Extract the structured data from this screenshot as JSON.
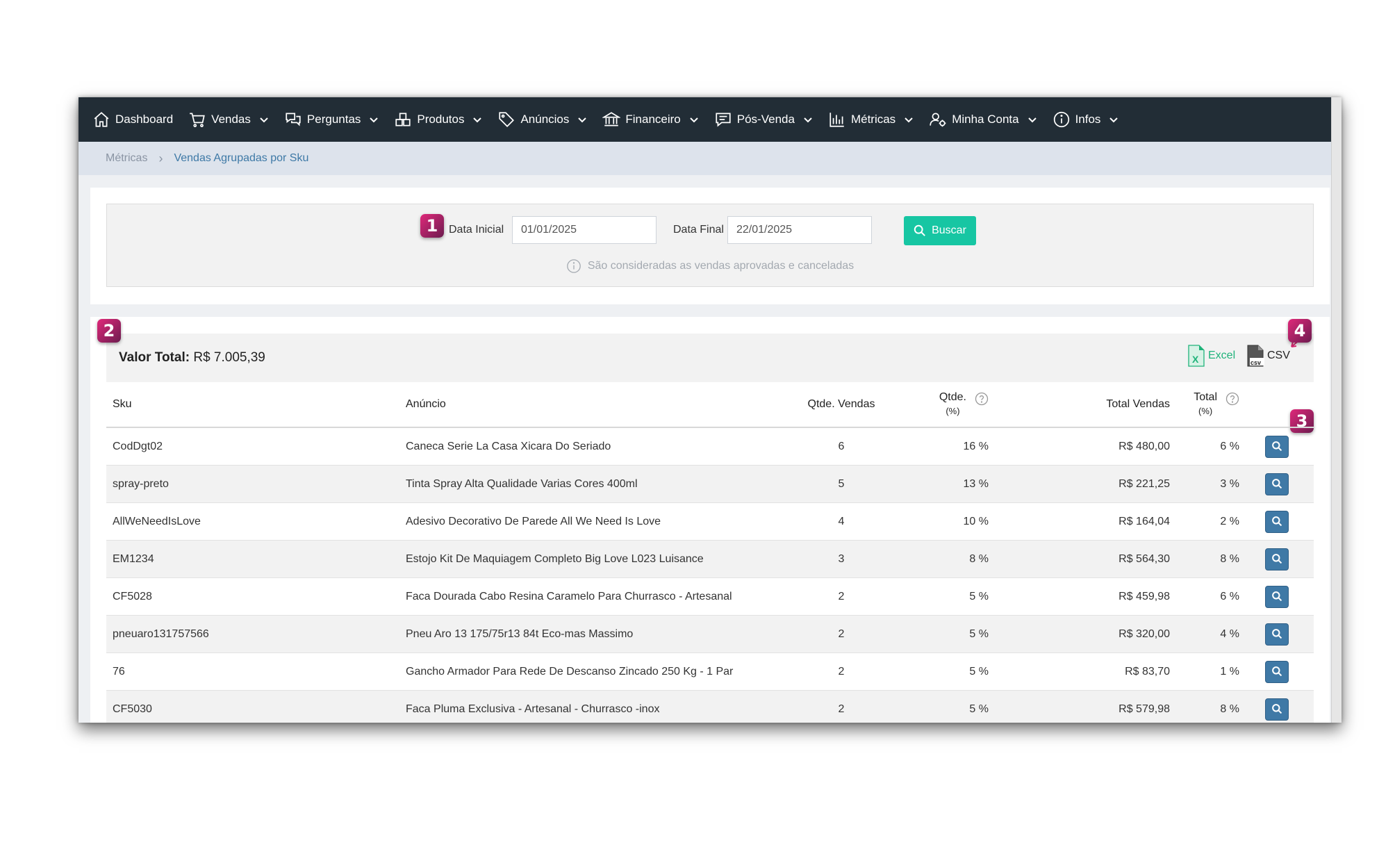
{
  "nav": {
    "items": [
      {
        "label": "Dashboard",
        "icon": "home-icon",
        "dropdown": false
      },
      {
        "label": "Vendas",
        "icon": "cart-icon",
        "dropdown": true
      },
      {
        "label": "Perguntas",
        "icon": "chat-bubbles-icon",
        "dropdown": true
      },
      {
        "label": "Produtos",
        "icon": "boxes-icon",
        "dropdown": true
      },
      {
        "label": "Anúncios",
        "icon": "tag-icon",
        "dropdown": true
      },
      {
        "label": "Financeiro",
        "icon": "bank-icon",
        "dropdown": true
      },
      {
        "label": "Pós-Venda",
        "icon": "message-icon",
        "dropdown": true
      },
      {
        "label": "Métricas",
        "icon": "bar-chart-icon",
        "dropdown": true
      },
      {
        "label": "Minha Conta",
        "icon": "user-gear-icon",
        "dropdown": true
      },
      {
        "label": "Infos",
        "icon": "info-icon",
        "dropdown": true
      }
    ]
  },
  "breadcrumb": {
    "root": "Métricas",
    "separator": "›",
    "current": "Vendas Agrupadas por Sku"
  },
  "filter": {
    "badge": "1",
    "start_label": "Data Inicial",
    "start_value": "01/01/2025",
    "end_label": "Data Final",
    "end_value": "22/01/2025",
    "search_label": "Buscar",
    "info_text": "São consideradas as vendas aprovadas e canceladas"
  },
  "summary": {
    "badge_total": "2",
    "badge_export": "4",
    "badge_action": "3",
    "total_label": "Valor Total:",
    "total_value": "R$ 7.005,39",
    "excel_label": "Excel",
    "csv_label": "CSV"
  },
  "table": {
    "headers": {
      "sku": "Sku",
      "anuncio": "Anúncio",
      "qtde_vendas": "Qtde. Vendas",
      "qtde_pct_top": "Qtde.",
      "qtde_pct_bottom": "(%)",
      "total_vendas": "Total Vendas",
      "total_pct_top": "Total",
      "total_pct_bottom": "(%)"
    },
    "rows": [
      {
        "sku": "CodDgt02",
        "anuncio": "Caneca Serie La Casa Xicara Do Seriado",
        "qtde": "6",
        "qtde_pct": "16 %",
        "total": "R$ 480,00",
        "total_pct": "6 %"
      },
      {
        "sku": "spray-preto",
        "anuncio": "Tinta Spray Alta Qualidade Varias Cores 400ml",
        "qtde": "5",
        "qtde_pct": "13 %",
        "total": "R$ 221,25",
        "total_pct": "3 %"
      },
      {
        "sku": "AllWeNeedIsLove",
        "anuncio": "Adesivo Decorativo De Parede All We Need Is Love",
        "qtde": "4",
        "qtde_pct": "10 %",
        "total": "R$ 164,04",
        "total_pct": "2 %"
      },
      {
        "sku": "EM1234",
        "anuncio": "Estojo Kit De Maquiagem Completo Big Love L023 Luisance",
        "qtde": "3",
        "qtde_pct": "8 %",
        "total": "R$ 564,30",
        "total_pct": "8 %"
      },
      {
        "sku": "CF5028",
        "anuncio": "Faca Dourada Cabo Resina Caramelo Para Churrasco - Artesanal",
        "qtde": "2",
        "qtde_pct": "5 %",
        "total": "R$ 459,98",
        "total_pct": "6 %"
      },
      {
        "sku": "pneuaro131757566",
        "anuncio": "Pneu Aro 13 175/75r13 84t Eco-mas Massimo",
        "qtde": "2",
        "qtde_pct": "5 %",
        "total": "R$ 320,00",
        "total_pct": "4 %"
      },
      {
        "sku": "76",
        "anuncio": "Gancho Armador Para Rede De Descanso Zincado 250 Kg - 1 Par",
        "qtde": "2",
        "qtde_pct": "5 %",
        "total": "R$ 83,70",
        "total_pct": "1 %"
      },
      {
        "sku": "CF5030",
        "anuncio": "Faca Pluma Exclusiva - Artesanal - Churrasco -inox",
        "qtde": "2",
        "qtde_pct": "5 %",
        "total": "R$ 579,98",
        "total_pct": "8 %"
      }
    ]
  },
  "colors": {
    "nav_bg": "#222d36",
    "accent": "#17c6a3",
    "action_btn": "#3f79a6",
    "badge": "#c4246c"
  }
}
